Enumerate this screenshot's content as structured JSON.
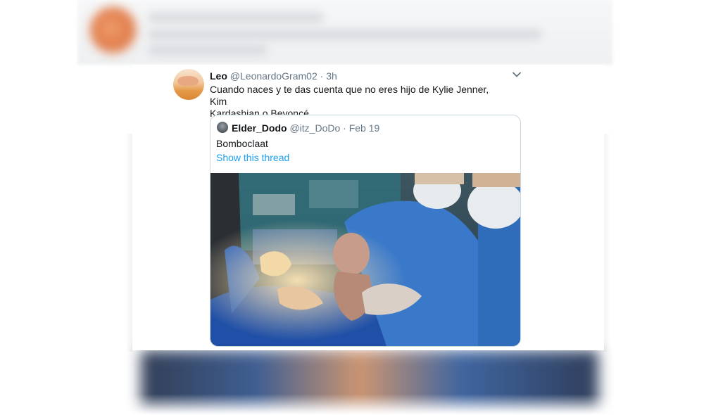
{
  "tweet": {
    "author_name": "Leo",
    "author_handle": "@LeonardoGram02",
    "separator": "·",
    "time": "3h",
    "text_line1": "Cuando naces y te das cuenta que no eres hijo de Kylie Jenner, Kim",
    "text_line2": "Kardashian o Beyoncé"
  },
  "quoted_tweet": {
    "author_name": "Elder_Dodo",
    "author_handle": "@itz_DoDo",
    "separator": "·",
    "date": "Feb 19",
    "text": "Bomboclaat",
    "thread_link": "Show this thread"
  },
  "icons": {
    "caret": "chevron-down-icon"
  },
  "colors": {
    "text": "#14171a",
    "muted": "#657786",
    "link": "#1da1f2",
    "border": "#ccd6dd"
  }
}
